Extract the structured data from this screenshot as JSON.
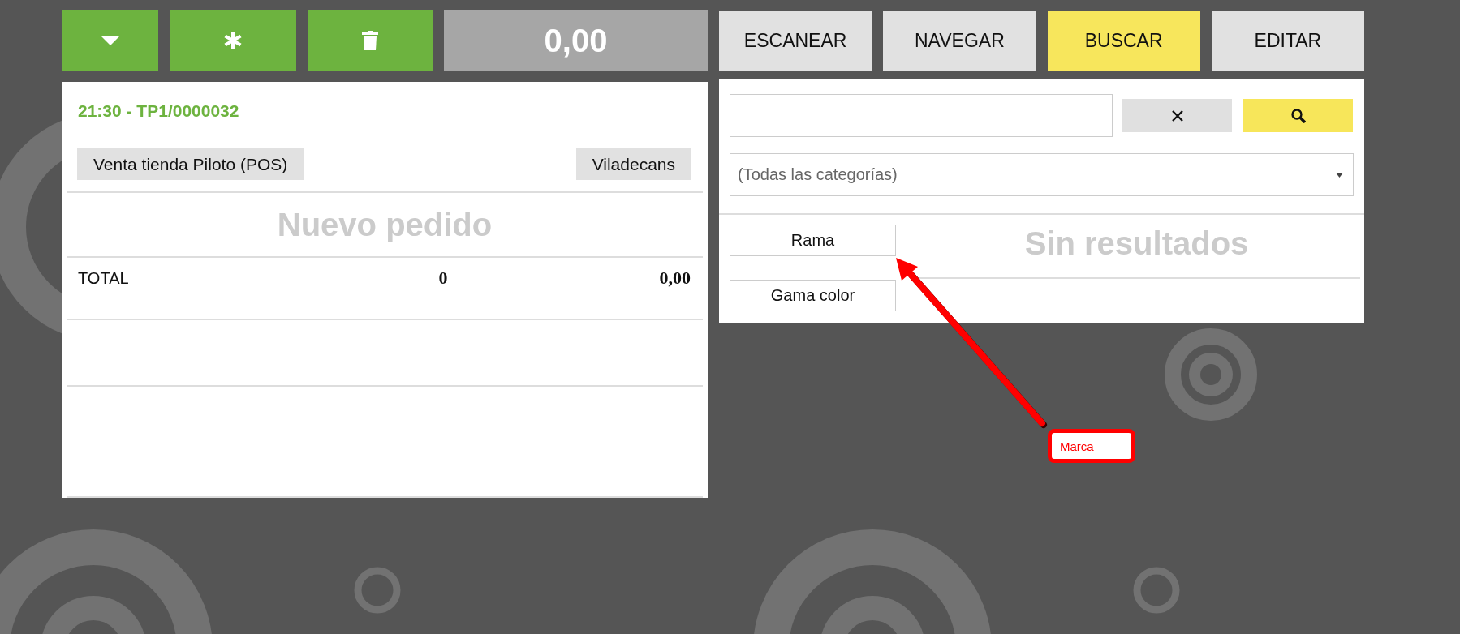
{
  "order_toolbar": {
    "amount": "0,00"
  },
  "order": {
    "title": "21:30 - TP1/0000032",
    "tags": [
      "Venta tienda Piloto (POS)",
      "Viladecans"
    ],
    "empty_message": "Nuevo pedido",
    "total": {
      "label": "TOTAL",
      "quantity": "0",
      "amount": "0,00"
    }
  },
  "tabs": [
    {
      "label": "ESCANEAR",
      "selected": false
    },
    {
      "label": "NAVEGAR",
      "selected": false
    },
    {
      "label": "BUSCAR",
      "selected": true
    },
    {
      "label": "EDITAR",
      "selected": false
    }
  ],
  "search": {
    "category": "(Todas las categorías)"
  },
  "filters": [
    {
      "label": "Rama"
    },
    {
      "label": "Gama color"
    }
  ],
  "results_message": "Sin resultados",
  "annotation": {
    "label": "Marca"
  }
}
